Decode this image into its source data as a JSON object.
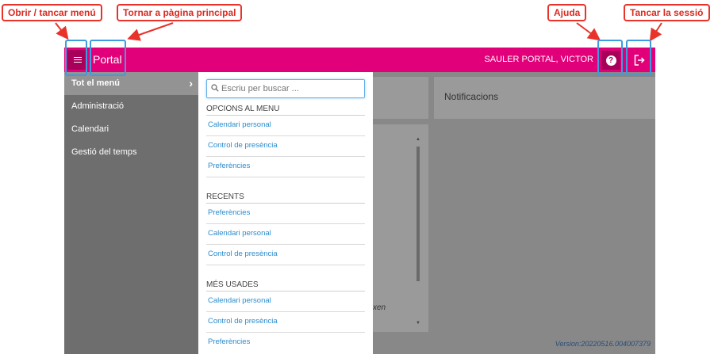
{
  "annotations": {
    "menu_toggle": "Obrir / tancar menú",
    "home": "Tornar a pàgina principal",
    "help": "Ajuda",
    "logout": "Tancar la sessió"
  },
  "topbar": {
    "title": "Portal",
    "user": "SAULER PORTAL, VICTOR",
    "help_glyph": "?"
  },
  "sidebar": {
    "items": [
      {
        "label": "Tot el menú"
      },
      {
        "label": "Administració"
      },
      {
        "label": "Calendari"
      },
      {
        "label": "Gestió del temps"
      }
    ]
  },
  "menu": {
    "search_placeholder": "Escriu per buscar ...",
    "sections": [
      {
        "title": "OPCIONS AL MENU",
        "links": [
          "Calendari personal",
          "Control de presència",
          "Preferències"
        ]
      },
      {
        "title": "RECENTS",
        "links": [
          "Preferències",
          "Calendari personal",
          "Control de presència"
        ]
      },
      {
        "title": "MÉS USADES",
        "links": [
          "Calendari personal",
          "Control de presència",
          "Preferències"
        ]
      }
    ]
  },
  "content": {
    "notifications_title": "Notificacions",
    "partial_text": "xen",
    "version": "Version:20220516.004007379"
  },
  "colors": {
    "brand": "#e2007a",
    "brand_dark": "#a8005a",
    "annotation": "#e8332a",
    "highlight": "#3d9be0",
    "link": "#2a8ccd"
  },
  "icons": [
    "hamburger-icon",
    "help-icon",
    "logout-icon",
    "search-icon",
    "chevron-right-icon"
  ]
}
